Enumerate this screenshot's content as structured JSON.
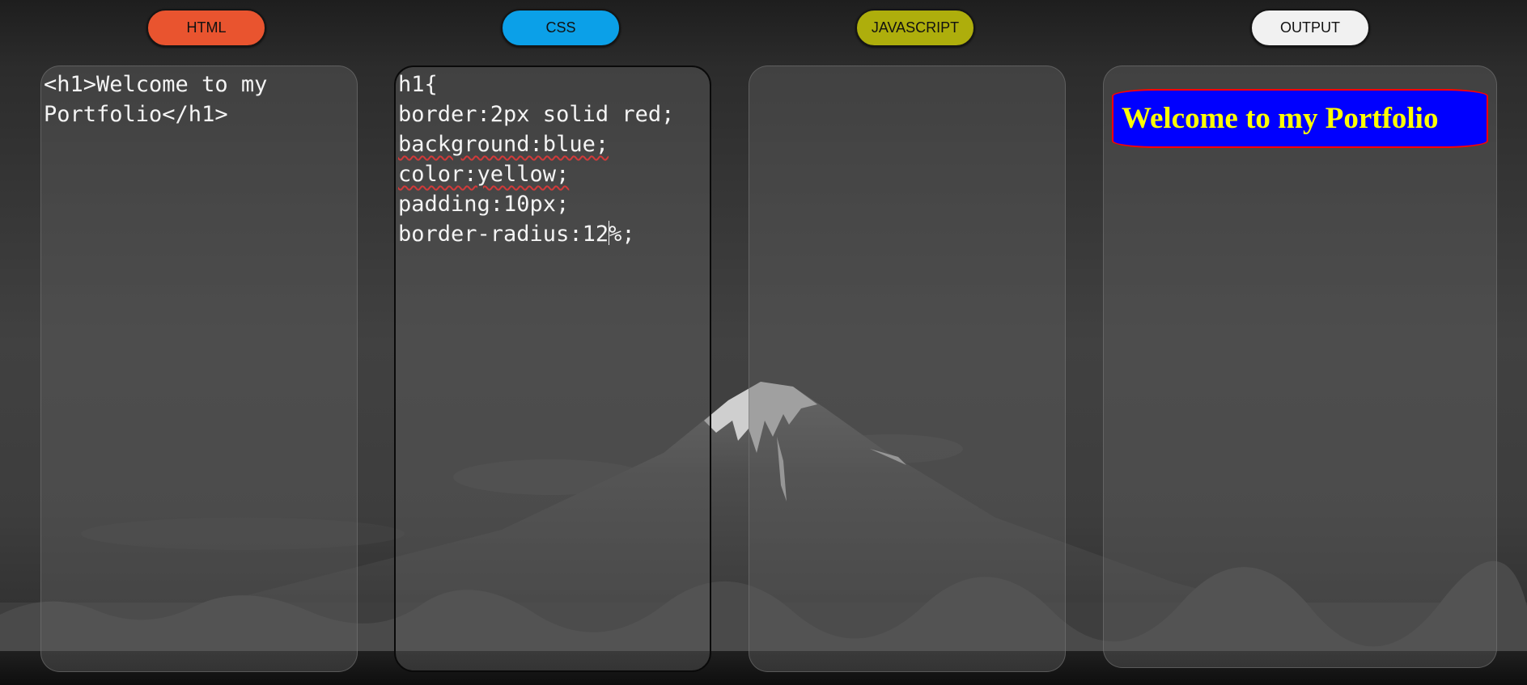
{
  "tabs": {
    "html": {
      "label": "HTML",
      "color": "#e9542f"
    },
    "css": {
      "label": "CSS",
      "color": "#0ba0e8"
    },
    "js": {
      "label": "JAVASCRIPT",
      "color": "#aeae0c"
    },
    "output": {
      "label": "OUTPUT",
      "color": "#f1f1f1"
    }
  },
  "editors": {
    "html": {
      "text": "<h1>Welcome to my Portfolio</h1>"
    },
    "css": {
      "lines": [
        "h1{",
        "border:2px solid red;",
        "background:blue;",
        "color:yellow;",
        "padding:10px;"
      ],
      "last_line_before_caret": "border-radius:12",
      "last_line_after_caret": "%;"
    },
    "js": {
      "text": ""
    }
  },
  "output": {
    "heading": "Welcome to my Portfolio",
    "colors": {
      "background": "#0000ff",
      "text": "#ffff00",
      "border": "#ff0000"
    }
  },
  "colors": {
    "panel_bg": "rgba(95,95,95,0.42)",
    "code_text": "#f4f4f4",
    "spell_error": "#d23a3a"
  }
}
